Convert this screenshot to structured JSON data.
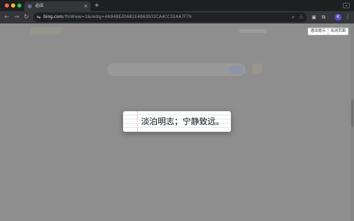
{
  "tab": {
    "title": "必应",
    "favicon": "globe-icon",
    "close": "×"
  },
  "new_tab": "+",
  "toolbar": {
    "back": "←",
    "forward": "→",
    "reload": "C",
    "url_host": "bing.com",
    "url_path": "/?toWww=1&redig=4A94BE20A81E4BA3933CA4CC32AA7F79",
    "zoom": "⌕",
    "star": "☆",
    "profile": "K",
    "menu": "⋮"
  },
  "page": {
    "exit_prompt_label": "退出提示",
    "close_page_label": "关闭页面",
    "quote": "淡泊明志；宁静致远。"
  },
  "colors": {
    "overlay": "#8e8e8e",
    "card": "#fdfdfd",
    "profile": "#5b4bc4"
  }
}
